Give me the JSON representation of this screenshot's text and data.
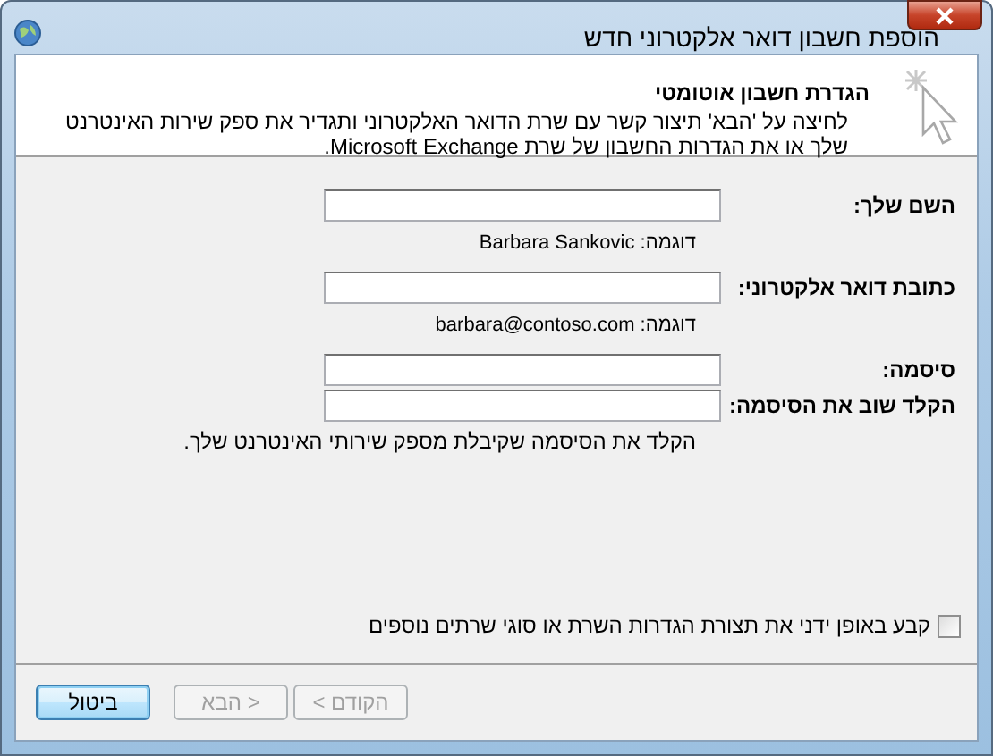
{
  "window": {
    "title": "הוספת חשבון דואר אלקטרוני חדש"
  },
  "header": {
    "title": "הגדרת חשבון אוטומטי",
    "description": "לחיצה על 'הבא' תיצור קשר עם שרת הדואר האלקטרוני ותגדיר את ספק שירות האינטרנט שלך או את הגדרות החשבון של שרת Microsoft Exchange."
  },
  "fields": [
    {
      "label": "השם שלך:",
      "hint": "דוגמה: Barbara Sankovic"
    },
    {
      "label": "כתובת דואר אלקטרוני:",
      "hint": "דוגמה: barbara@contoso.com"
    },
    {
      "label": "סיסמה:"
    },
    {
      "label": "הקלד שוב את הסיסמה:",
      "hint": "הקלד את הסיסמה שקיבלת מספק שירותי האינטרנט שלך."
    }
  ],
  "manual_setup": {
    "label": "קבע באופן ידני את תצורת הגדרות השרת או סוגי שרתים נוספים",
    "checked": false
  },
  "buttons": [
    {
      "label": "< הקודם",
      "kind": "nav",
      "disabled": true
    },
    {
      "label": "הבא >",
      "kind": "nav",
      "disabled": true
    },
    {
      "label": "ביטול",
      "kind": "cancel",
      "disabled": false
    }
  ]
}
